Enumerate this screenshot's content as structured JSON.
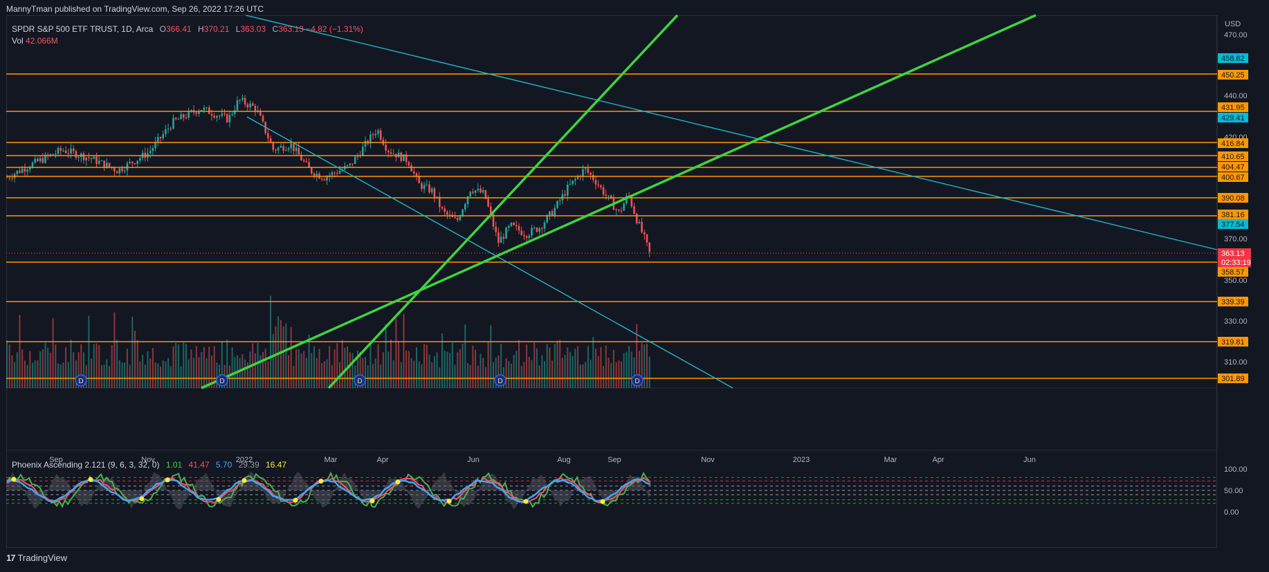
{
  "header": {
    "published_text": "MannyTman published on TradingView.com, Sep 26, 2022 17:26 UTC"
  },
  "legend": {
    "symbol": "SPDR S&P 500 ETF TRUST, 1D, Arca",
    "open_label": "O",
    "open": "366.41",
    "high_label": "H",
    "high": "370.21",
    "low_label": "L",
    "low": "363.03",
    "close_label": "C",
    "close": "363.13",
    "change": "−4.82 (−1.31%)",
    "vol_label": "Vol",
    "vol": "42.066M"
  },
  "indicator": {
    "name": "Phoenix Ascending 2.121 (9, 6, 3, 32, 0)",
    "v1": "1.01",
    "v2": "41.47",
    "v3": "5.70",
    "v4": "29.39",
    "v5": "16.47"
  },
  "footer": {
    "logo": "17",
    "brand": "TradingView"
  },
  "colors": {
    "background": "#131722",
    "up_candle": "#26a69a",
    "down_candle": "#ef5350",
    "level_line": "#ff9800",
    "trend_green": "#3fd43f",
    "channel_cyan": "#22b5cc",
    "price_badge": "#f23645",
    "cyan_badge": "#00bcd4"
  },
  "price_axis": {
    "currency": "USD",
    "ticks": [
      "470.00",
      "440.00",
      "420.00",
      "370.00",
      "350.00",
      "330.00",
      "310.00"
    ]
  },
  "price_badges": [
    {
      "text": "458.62",
      "color": "#00bcd4"
    },
    {
      "text": "450.25",
      "color": "#ff9800"
    },
    {
      "text": "431.95",
      "color": "#ff9800"
    },
    {
      "text": "429.41",
      "color": "#00bcd4"
    },
    {
      "text": "416.84",
      "color": "#ff9800"
    },
    {
      "text": "410.65",
      "color": "#ff9800"
    },
    {
      "text": "404.47",
      "color": "#ff9800"
    },
    {
      "text": "400.67",
      "color": "#ff9800"
    },
    {
      "text": "390.08",
      "color": "#ff9800"
    },
    {
      "text": "381.16",
      "color": "#ff9800"
    },
    {
      "text": "377.54",
      "color": "#00bcd4"
    },
    {
      "text": "358.57",
      "color": "#ff9800"
    },
    {
      "text": "339.39",
      "color": "#ff9800"
    },
    {
      "text": "319.81",
      "color": "#ff9800"
    },
    {
      "text": "301.89",
      "color": "#ff9800"
    }
  ],
  "last_price": {
    "price": "363.13",
    "countdown": "02:33:19"
  },
  "time_axis": [
    "Sep",
    "Nov",
    "2022",
    "Mar",
    "Apr",
    "Jun",
    "Aug",
    "Sep",
    "Nov",
    "2023",
    "Mar",
    "Apr",
    "Jun"
  ],
  "oscillator_axis": [
    "100.00",
    "50.00",
    "0.00"
  ],
  "dividend_marker": "D"
}
